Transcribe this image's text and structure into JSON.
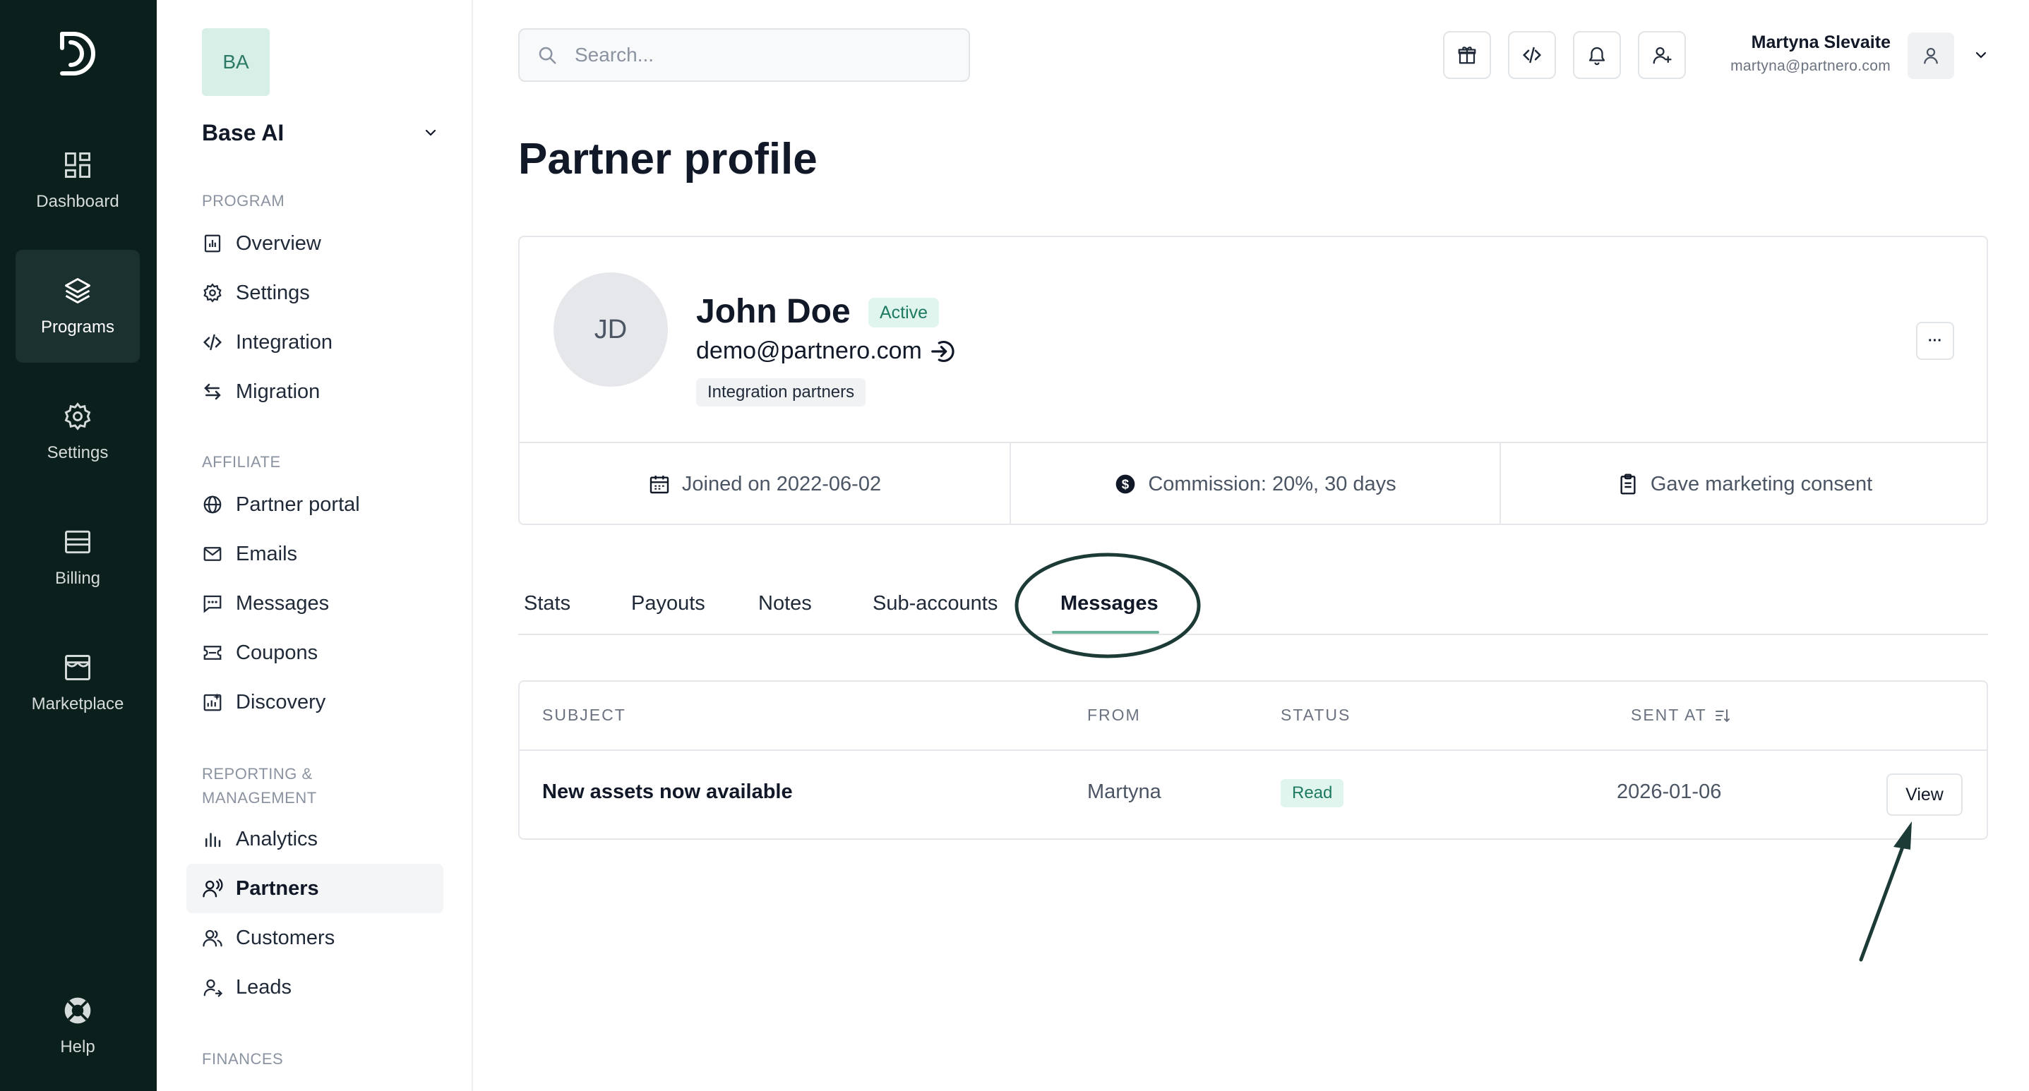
{
  "rail": {
    "items": [
      {
        "label": "Dashboard",
        "icon": "dashboard-icon"
      },
      {
        "label": "Programs",
        "icon": "layers-icon"
      },
      {
        "label": "Settings",
        "icon": "gear-icon"
      },
      {
        "label": "Billing",
        "icon": "wallet-icon"
      },
      {
        "label": "Marketplace",
        "icon": "store-icon"
      }
    ],
    "help": "Help"
  },
  "sidebar": {
    "org_initials": "BA",
    "org_name": "Base AI",
    "program_label": "PROGRAM",
    "program_items": [
      "Overview",
      "Settings",
      "Integration",
      "Migration"
    ],
    "affiliate_label": "AFFILIATE",
    "affiliate_items": [
      "Partner portal",
      "Emails",
      "Messages",
      "Coupons",
      "Discovery"
    ],
    "reporting_label_line1": "REPORTING &",
    "reporting_label_line2": "MANAGEMENT",
    "reporting_items": [
      "Analytics",
      "Partners",
      "Customers",
      "Leads"
    ],
    "finances_label": "FINANCES",
    "active_item": "Partners"
  },
  "topbar": {
    "search_placeholder": "Search...",
    "user_name": "Martyna Slevaite",
    "user_email": "martyna@partnero.com"
  },
  "page": {
    "title": "Partner profile"
  },
  "profile": {
    "initials": "JD",
    "name": "John Doe",
    "status": "Active",
    "email": "demo@partnero.com",
    "tag": "Integration partners",
    "more_label": "···",
    "joined": "Joined on 2022-06-02",
    "commission": "Commission: 20%, 30 days",
    "consent": "Gave marketing consent"
  },
  "tabs": [
    "Stats",
    "Payouts",
    "Notes",
    "Sub-accounts",
    "Messages"
  ],
  "active_tab": "Messages",
  "messages_table": {
    "headers": {
      "subject": "SUBJECT",
      "from": "FROM",
      "status": "STATUS",
      "sent_at": "SENT AT"
    },
    "rows": [
      {
        "subject": "New assets now available",
        "from": "Martyna",
        "status": "Read",
        "sent_at": "2026-01-06",
        "action": "View"
      }
    ]
  },
  "colors": {
    "rail_bg": "#0b1f1d",
    "accent": "#6bb49c",
    "badge_bg": "#dff5ee",
    "badge_text": "#1e7a61",
    "annotation": "#1c3b36"
  }
}
